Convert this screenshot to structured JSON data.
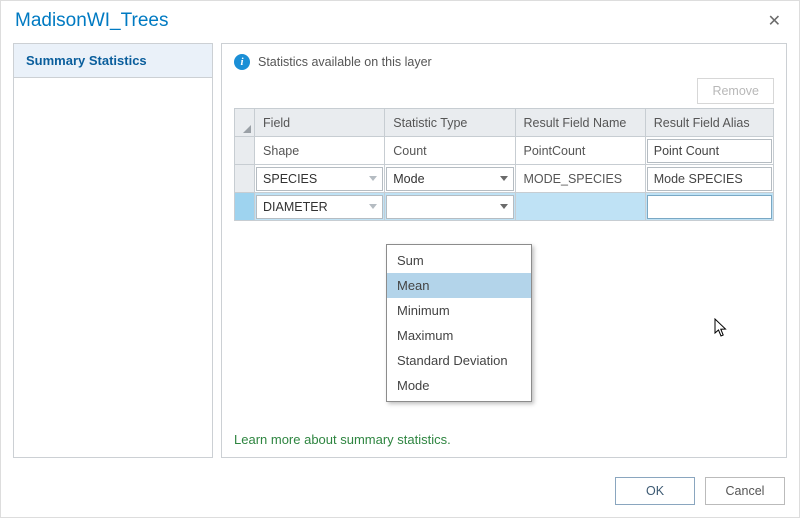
{
  "title": "MadisonWI_Trees",
  "sidebar": {
    "heading": "Summary Statistics"
  },
  "info_text": "Statistics available on this layer",
  "remove_label": "Remove",
  "columns": {
    "field": "Field",
    "stat": "Statistic Type",
    "result_name": "Result Field Name",
    "result_alias": "Result Field Alias"
  },
  "rows": [
    {
      "field": "Shape",
      "stat": "Count",
      "result_name": "PointCount",
      "result_alias": "Point Count",
      "field_is_combo": false,
      "stat_is_combo": false
    },
    {
      "field": "SPECIES",
      "stat": "Mode",
      "result_name": "MODE_SPECIES",
      "result_alias": "Mode SPECIES",
      "field_is_combo": true,
      "stat_is_combo": true
    },
    {
      "field": "DIAMETER",
      "stat": "",
      "result_name": "",
      "result_alias": "",
      "field_is_combo": true,
      "stat_is_combo": true,
      "selected": true
    }
  ],
  "dropdown": {
    "options": [
      "Sum",
      "Mean",
      "Minimum",
      "Maximum",
      "Standard Deviation",
      "Mode"
    ],
    "hover": "Mean"
  },
  "learn_link": "Learn more about summary statistics.",
  "buttons": {
    "ok": "OK",
    "cancel": "Cancel"
  }
}
